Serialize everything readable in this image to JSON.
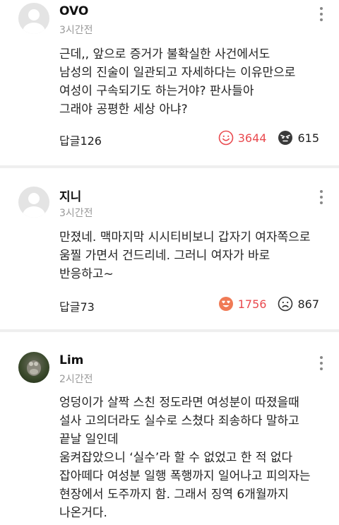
{
  "comments": [
    {
      "name": "OVO",
      "time": "3시간전",
      "lines": [
        "근데,, 앞으로 증거가 불확실한 사건에서도",
        "남성의 진술이 일관되고 자세하다는 이유만으로",
        "여성이 구속되기도 하는거야? 판사들아",
        "그래야 공평한 세상 아냐?"
      ],
      "reply": "답글126",
      "likes": "3644",
      "dislikes": "615",
      "like_icon": "smile-outline-icon",
      "dislike_icon": "angry-face-icon"
    },
    {
      "name": "지니",
      "time": "3시간전",
      "lines": [
        "만졌네. 맥마지막 시시티비보니 갑자기 여자쪽으로",
        "움찔 가면서 건드리네.  그러니 여자가 바로",
        "반응하고~"
      ],
      "reply": "답글73",
      "likes": "1756",
      "dislikes": "867",
      "like_icon": "love-face-icon",
      "dislike_icon": "sad-outline-icon"
    },
    {
      "name": "Lim",
      "time": "2시간전",
      "lines": [
        "엉덩이가 살짝 스친 정도라면 여성분이 따졌을때",
        "설사 고의더라도 실수로 스쳤다 죄송하다 말하고",
        "끝날 일인데",
        "움켜잡았으니 ‘실수’라 할 수 없었고 한 적 없다",
        "잡아떼다 여성분 일행 폭행까지 일어나고 피의자는",
        "현장에서 도주까지 함. 그래서 징역 6개월까지",
        "나온거다."
      ]
    }
  ],
  "colors": {
    "like": "#e94a4f",
    "separator": "#efefef",
    "meta": "#999999"
  }
}
